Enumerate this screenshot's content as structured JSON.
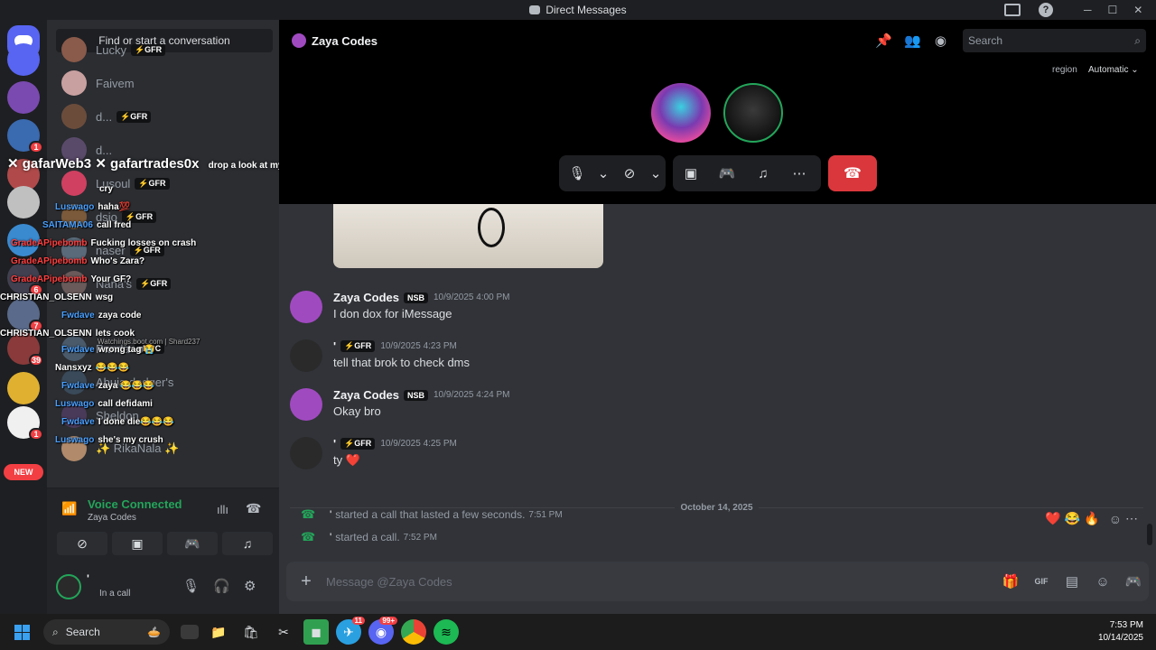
{
  "window": {
    "title": "Direct Messages",
    "controls": [
      "─",
      "☐",
      "✕"
    ]
  },
  "sidebar": {
    "find_label": "Find or start a conversation",
    "items": [
      {
        "name": "Lucky",
        "badge": "⚡GFR",
        "color": "#8a5a4a"
      },
      {
        "name": "Faivem",
        "badge": "",
        "color": "#c9a0a0"
      },
      {
        "name": "d...",
        "badge": "⚡GFR",
        "color": "#6b4c3b"
      },
      {
        "name": "d...",
        "badge": "",
        "color": "#5a4a6a"
      },
      {
        "name": "Lusoul",
        "badge": "⚡GFR",
        "color": "#d04060"
      },
      {
        "name": "dsio",
        "badge": "⚡GFR",
        "color": "#7a5a3a"
      },
      {
        "name": "naser",
        "badge": "⚡GFR",
        "color": "#5a6a7a"
      },
      {
        "name": "Nana's",
        "badge": "⚡GFR",
        "color": "#6a5a5a"
      },
      {
        "name": "Panda",
        "badge": "gMPC",
        "color": "#4a5a6a"
      },
      {
        "name": "Abuja dodger's",
        "badge": "",
        "color": "#3a4a5a"
      },
      {
        "name": "Sheldon",
        "badge": "",
        "color": "#4a3a5a"
      },
      {
        "name": "✨ RikaNala ✨",
        "badge": "",
        "color": "#b08a6a"
      }
    ]
  },
  "guilds": [
    {
      "color": "#5865f2",
      "badge": ""
    },
    {
      "color": "#7a4ab0",
      "badge": ""
    },
    {
      "color": "#3a6ab0",
      "badge": "1"
    },
    {
      "color": "#b04a4a",
      "badge": ""
    },
    {
      "color": "#c0c0c0",
      "badge": ""
    },
    {
      "color": "#3a8ad0",
      "badge": ""
    },
    {
      "color": "#404050",
      "badge": "6"
    },
    {
      "color": "#5a6a8a",
      "badge": "7"
    },
    {
      "color": "#8a3a3a",
      "badge": "39"
    },
    {
      "color": "#e0b030",
      "badge": ""
    },
    {
      "color": "#f0f0f0",
      "badge": "1"
    },
    {
      "color": "#2a7ad0",
      "badge": ""
    }
  ],
  "new_pill": "NEW",
  "overlay": {
    "header": "✕ gafarWeb3  ✕ gafartrades0x",
    "header_tail": "drop a look at my history on dospamp you'd",
    "lines": [
      {
        "user": "",
        "text": "cry",
        "color": "#ffffff"
      },
      {
        "user": "Luswago",
        "text": "haha💯",
        "color": "#4aa0ff"
      },
      {
        "user": "SAITAMA06",
        "text": "call fred",
        "color": "#4aa0ff"
      },
      {
        "user": "GradeAPipebomb",
        "text": "Fucking losses on crash",
        "color": "#ff4040"
      },
      {
        "user": "GradeAPipebomb",
        "text": "Who's Zara?",
        "color": "#ff4040"
      },
      {
        "user": "GradeAPipebomb",
        "text": "Your GF?",
        "color": "#ff4040"
      },
      {
        "user": "CHRISTIAN_OLSENN",
        "text": "wsg",
        "color": "#ffffff"
      },
      {
        "user": "Fwdave",
        "text": "zaya code",
        "color": "#4aa0ff"
      },
      {
        "user": "CHRISTIAN_OLSENN",
        "text": "lets cook",
        "color": "#ffffff"
      },
      {
        "user": "Fwdave",
        "text": "wrong tag 😭",
        "color": "#4aa0ff"
      },
      {
        "user": "Nansxyz",
        "text": "😂😂😂",
        "color": "#ffffff"
      },
      {
        "user": "Fwdave",
        "text": "zaya 😂😂😂",
        "color": "#4aa0ff"
      },
      {
        "user": "Luswago",
        "text": "call defidami",
        "color": "#4aa0ff"
      },
      {
        "user": "Fwdave",
        "text": "I done die😂😂😂",
        "color": "#4aa0ff"
      },
      {
        "user": "Luswago",
        "text": "she's my crush",
        "color": "#4aa0ff"
      }
    ],
    "watermark": "Watchings.boot.com | Shard237"
  },
  "voice": {
    "title": "Voice Connected",
    "channel": "Zaya Codes"
  },
  "user_panel": {
    "name": "'",
    "status": "In a call"
  },
  "topbar": {
    "dm_name": "Zaya Codes",
    "search_placeholder": "Search",
    "region_label": "region",
    "region_value": "Automatic"
  },
  "messages": [
    {
      "author": "Zaya Codes",
      "tag": "NSB",
      "time": "10/9/2025 4:00 PM",
      "text": "I don dox for iMessage",
      "avatar": "#a04ac0"
    },
    {
      "author": "'",
      "tag": "⚡GFR",
      "time": "10/9/2025 4:23 PM",
      "text": "tell that brok to check dms",
      "avatar": "#2a2a2a"
    },
    {
      "author": "Zaya Codes",
      "tag": "NSB",
      "time": "10/9/2025 4:24 PM",
      "text": "Okay bro",
      "avatar": "#a04ac0"
    },
    {
      "author": "'",
      "tag": "⚡GFR",
      "time": "10/9/2025 4:25 PM",
      "text": "ty ❤️",
      "avatar": "#2a2a2a"
    }
  ],
  "date_divider": "October 14, 2025",
  "system_messages": [
    {
      "author": "'",
      "text": "started a call that lasted a few seconds.",
      "time": "7:51 PM"
    },
    {
      "author": "'",
      "text": "started a call.",
      "time": "7:52 PM"
    }
  ],
  "reactions": [
    "❤️",
    "😂",
    "🔥"
  ],
  "composer": {
    "placeholder": "Message @Zaya Codes"
  },
  "taskbar": {
    "search_label": "Search",
    "time": "7:53 PM",
    "date": "10/14/2025",
    "telegram_badge": "11",
    "discord_badge": "99+"
  }
}
